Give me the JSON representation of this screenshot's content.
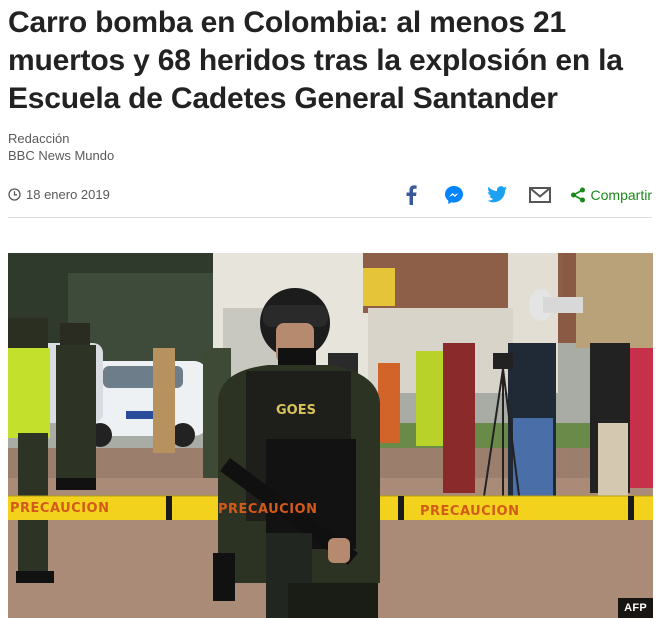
{
  "article": {
    "headline": "Carro bomba en Colombia: al menos 21 muertos y 68 heridos tras la explosión en la Escuela de Cadetes General Santander",
    "author": "Redacción",
    "outlet": "BBC News Mundo",
    "date": "18 enero 2019"
  },
  "share": {
    "icons": [
      "facebook-icon",
      "messenger-icon",
      "twitter-icon",
      "email-icon",
      "share-icon"
    ],
    "label": "Compartir"
  },
  "photo": {
    "credit": "AFP",
    "tape_text": "PRECAUCION",
    "vest_text": "GOES"
  },
  "colors": {
    "facebook": "#3b5998",
    "messenger": "#0084ff",
    "twitter": "#1da1f2",
    "share": "#1a8a1a",
    "tape_yellow": "#f2d21c"
  }
}
